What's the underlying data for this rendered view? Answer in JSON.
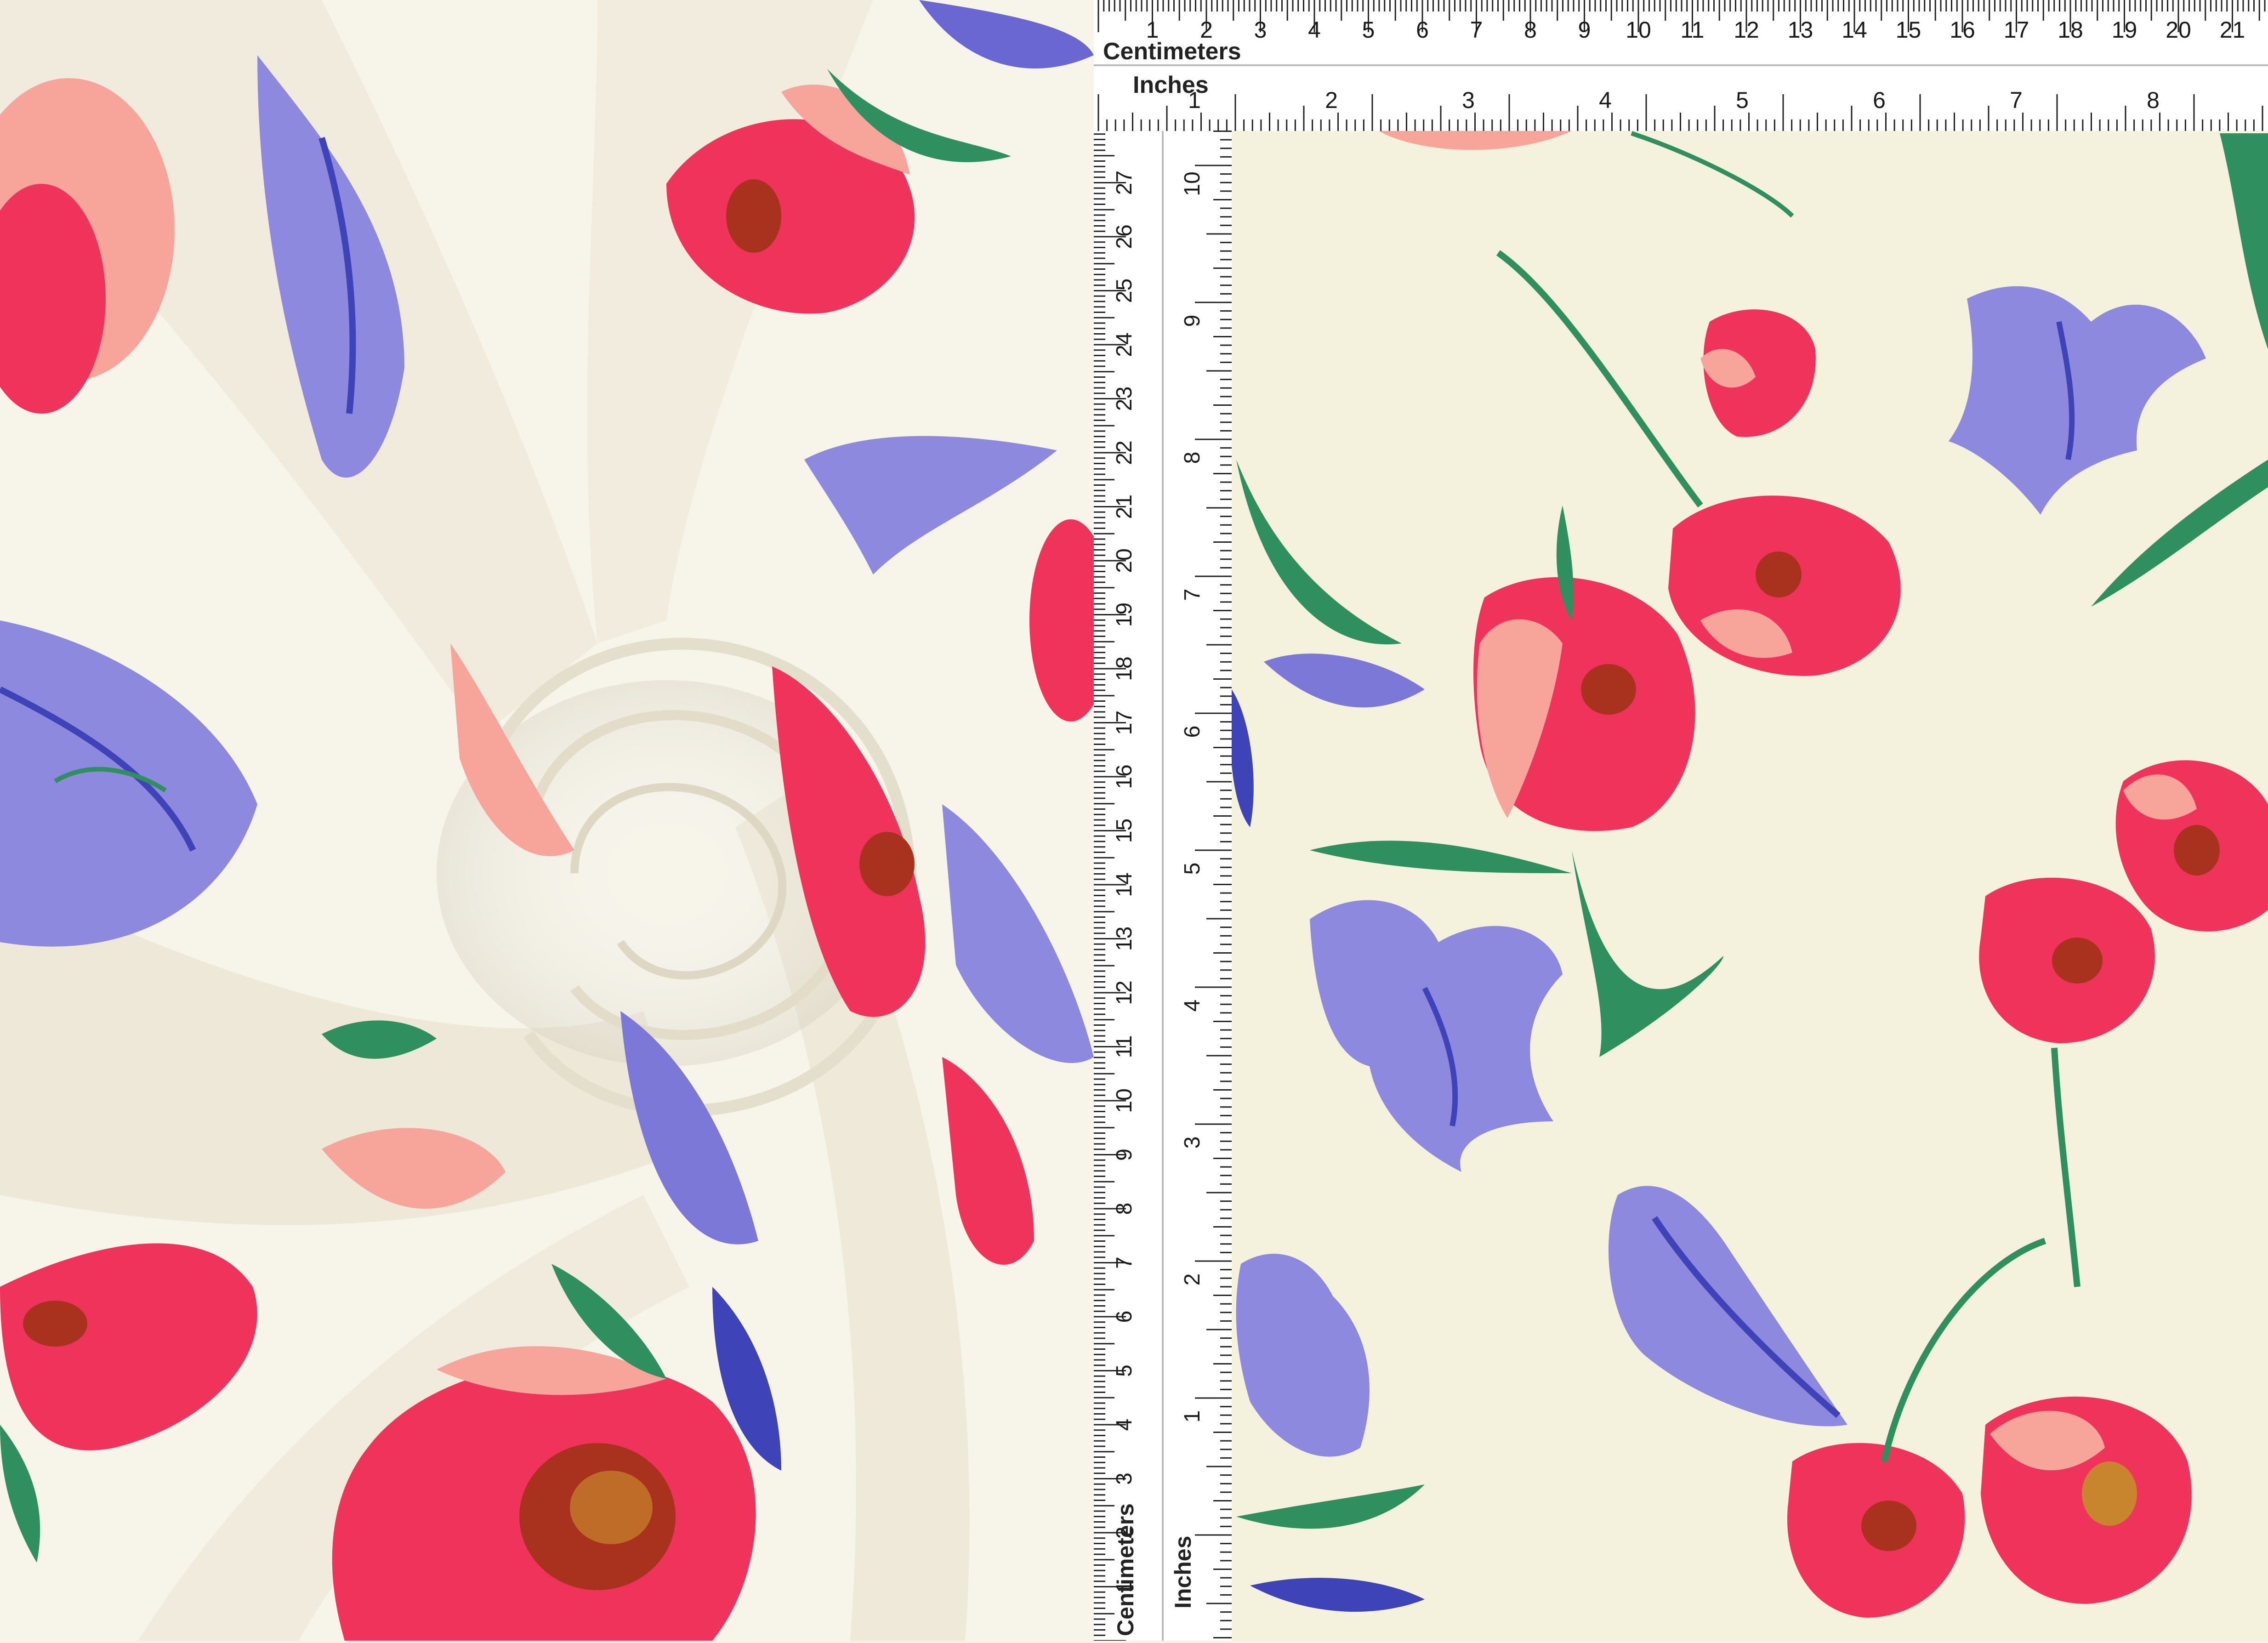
{
  "rulers": {
    "top_cm_label": "Centimeters",
    "top_in_label": "Inches",
    "side_cm_label": "Centimeters",
    "side_in_label": "Inches",
    "top_cm_numbers": [
      "1",
      "2",
      "3",
      "4",
      "5",
      "6",
      "7",
      "8",
      "9",
      "10",
      "11",
      "12",
      "13",
      "14",
      "15",
      "16",
      "17",
      "18",
      "19",
      "20",
      "21"
    ],
    "top_in_numbers": [
      "1",
      "2",
      "3",
      "4",
      "5",
      "6",
      "7",
      "8"
    ],
    "side_cm_numbers": [
      "1",
      "2",
      "3",
      "4",
      "5",
      "6",
      "7",
      "8",
      "9",
      "10",
      "11",
      "12",
      "13",
      "14",
      "15",
      "16",
      "17",
      "18",
      "19",
      "20",
      "21",
      "22",
      "23",
      "24",
      "25",
      "26",
      "27"
    ],
    "side_in_numbers": [
      "1",
      "2",
      "3",
      "4",
      "5",
      "6",
      "7",
      "8",
      "9",
      "10"
    ]
  },
  "colors": {
    "fabric": "#f6f2e6",
    "fabric_flat": "#f4f1dd",
    "ruler": "#ffffff",
    "poppy": "#f0335a",
    "poppy_light": "#f7a49b",
    "poppy_center": "#a8321e",
    "lily": "#7b78d8",
    "lily_dark": "#3f43b8",
    "leaf": "#2f8f5e"
  }
}
